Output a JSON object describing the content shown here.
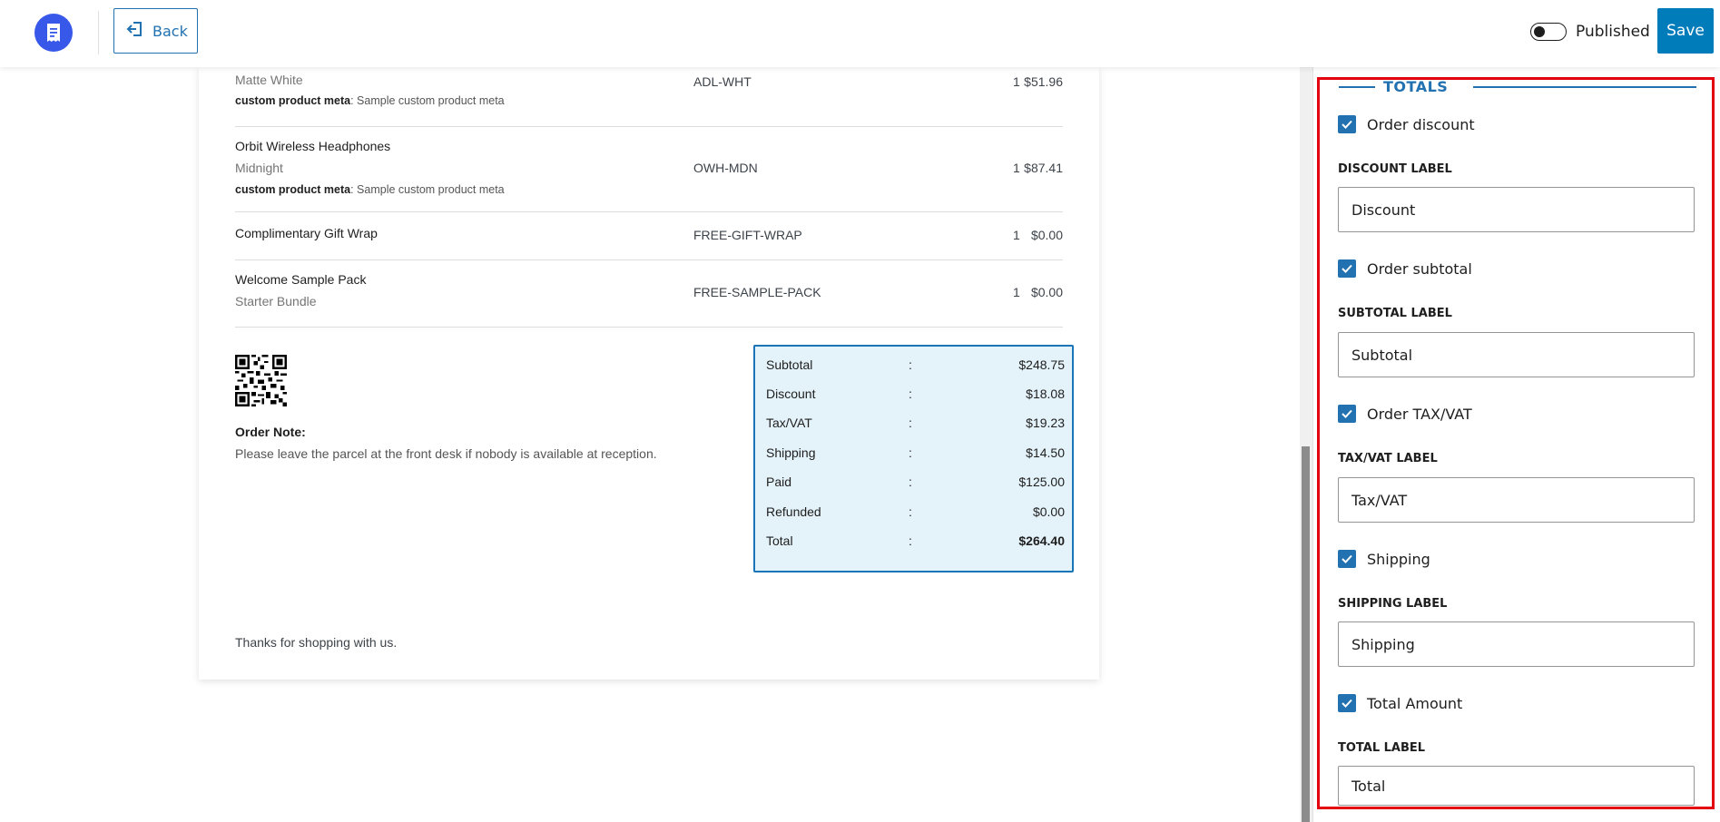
{
  "header": {
    "back_label": "Back",
    "status_label": "Published",
    "save_label": "Save"
  },
  "items": [
    {
      "name": "",
      "variant": "Matte White",
      "meta_key": "custom product meta",
      "meta_value": ": Sample custom product meta",
      "sku": "ADL-WHT",
      "qty": "1",
      "price": "$51.96"
    },
    {
      "name": "Orbit Wireless Headphones",
      "variant": "Midnight",
      "meta_key": "custom product meta",
      "meta_value": ": Sample custom product meta",
      "sku": "OWH-MDN",
      "qty": "1",
      "price": "$87.41"
    },
    {
      "name": "Complimentary Gift Wrap",
      "sku": "FREE-GIFT-WRAP",
      "qty": "1",
      "price": "$0.00"
    },
    {
      "name": "Welcome Sample Pack",
      "variant": "Starter Bundle",
      "sku": "FREE-SAMPLE-PACK",
      "qty": "1",
      "price": "$0.00"
    }
  ],
  "note": {
    "label": "Order Note:",
    "text": "Please leave the parcel at the front desk if nobody is available at reception."
  },
  "totals": [
    {
      "label": "Subtotal",
      "sep": ":",
      "value": "$248.75"
    },
    {
      "label": "Discount",
      "sep": ":",
      "value": "$18.08"
    },
    {
      "label": "Tax/VAT",
      "sep": ":",
      "value": "$19.23"
    },
    {
      "label": "Shipping",
      "sep": ":",
      "value": "$14.50"
    },
    {
      "label": "Paid",
      "sep": ":",
      "value": "$125.00"
    },
    {
      "label": "Refunded",
      "sep": ":",
      "value": "$0.00"
    },
    {
      "label": "Total",
      "sep": ":",
      "value": "$264.40"
    }
  ],
  "footer_text": "Thanks for shopping with us.",
  "panel": {
    "section_title": "TOTALS",
    "options": [
      {
        "check_label": "Order discount",
        "field_label": "DISCOUNT LABEL",
        "value": "Discount",
        "checked": true
      },
      {
        "check_label": "Order subtotal",
        "field_label": "SUBTOTAL LABEL",
        "value": "Subtotal",
        "checked": true
      },
      {
        "check_label": "Order TAX/VAT",
        "field_label": "TAX/VAT LABEL",
        "value": "Tax/VAT",
        "checked": true
      },
      {
        "check_label": "Shipping",
        "field_label": "SHIPPING LABEL",
        "value": "Shipping",
        "checked": true
      },
      {
        "check_label": "Total Amount",
        "field_label": "TOTAL LABEL",
        "value": "Total",
        "checked": true
      }
    ]
  },
  "colors": {
    "accent": "#2271b1",
    "save": "#007cba",
    "logo": "#3858e9",
    "highlight": "#e3000f",
    "totals_bg": "#e4f2f9"
  },
  "icons": {
    "logo": "receipt-icon",
    "back": "exit-arrow-icon",
    "check": "checkmark-icon"
  }
}
